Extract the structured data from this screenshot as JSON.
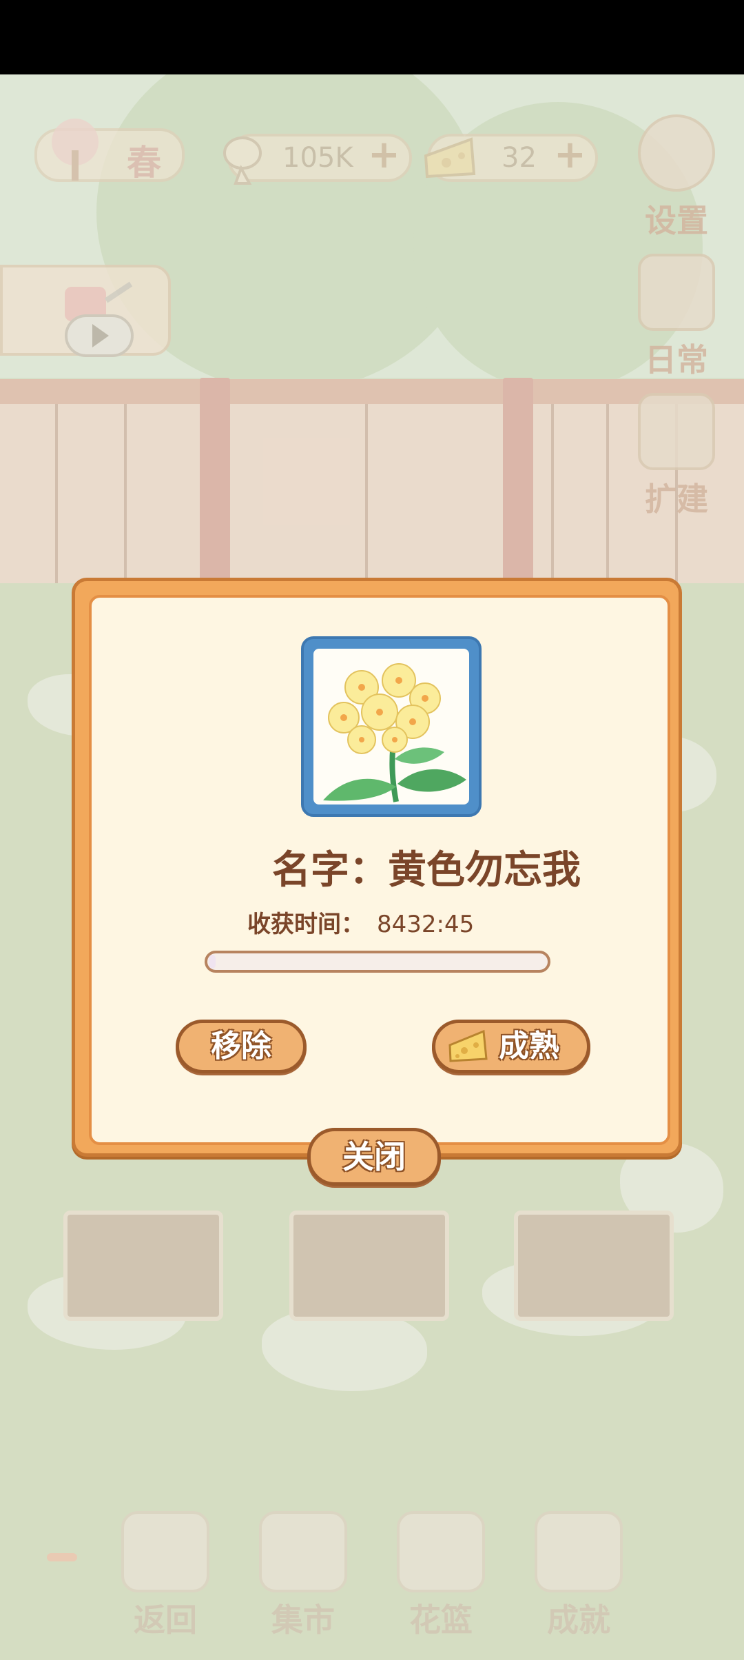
{
  "hud": {
    "season_label": "春",
    "fish_amount": "105K",
    "cheese_amount": "32",
    "plus_symbol": "+"
  },
  "side_menu": {
    "settings_label": "设置",
    "daily_label": "日常",
    "expand_label": "扩建"
  },
  "bottom_nav": {
    "back_label": "返回",
    "market_label": "集市",
    "basket_label": "花篮",
    "achievement_label": "成就"
  },
  "dialog": {
    "name_text": "名字：黄色勿忘我",
    "harvest_label": "收获时间：",
    "harvest_value": "8432:45",
    "progress_fraction": 0.02,
    "remove_label": "移除",
    "ripen_label": "成熟",
    "close_label": "关闭"
  },
  "colors": {
    "dialog_orange": "#f2a85b",
    "dialog_inner": "#fef6e2",
    "text_brown": "#7a4529",
    "frame_blue": "#4f8fc9"
  },
  "icons": [
    "tree-icon",
    "fish-bone-icon",
    "cheese-icon",
    "gear-icon",
    "clipboard-icon",
    "hammer-icon",
    "watering-can-icon",
    "play-icon",
    "gate-icon",
    "market-stall-icon",
    "flower-basket-icon",
    "trophy-icon",
    "forget-me-not-flower"
  ]
}
